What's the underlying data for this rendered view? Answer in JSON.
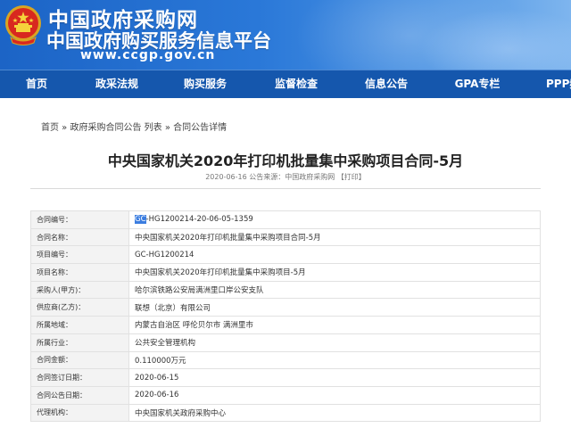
{
  "header": {
    "site_name": "中国政府采购网",
    "site_subtitle": "中国政府购买服务信息平台",
    "url": "www.ccgp.gov.cn",
    "emblem_icon": "national-emblem-icon",
    "colors": {
      "banner": "#2a78d8",
      "nav": "#1557ad"
    }
  },
  "nav": {
    "items": [
      {
        "label": "首页"
      },
      {
        "label": "政采法规"
      },
      {
        "label": "购买服务"
      },
      {
        "label": "监督检查"
      },
      {
        "label": "信息公告"
      },
      {
        "label": "GPA专栏"
      },
      {
        "label": "PPP频"
      }
    ]
  },
  "breadcrumb": {
    "home": "首页",
    "sep1": " » ",
    "list": "政府采购合同公告 列表",
    "sep2": " » ",
    "current": "合同公告详情"
  },
  "article": {
    "title": "中央国家机关2020年打印机批量集中采购项目合同-5月",
    "meta": "2020-06-16 公告来源：中国政府采购网 【打印】"
  },
  "contract": {
    "rows": [
      {
        "key": "合同编号：",
        "value_sel": "GC",
        "value": "-HG1200214-20-06-05-1359"
      },
      {
        "key": "合同名称：",
        "value": "中央国家机关2020年打印机批量集中采购项目合同-5月"
      },
      {
        "key": "项目编号：",
        "value": "GC-HG1200214"
      },
      {
        "key": "项目名称：",
        "value": "中央国家机关2020年打印机批量集中采购项目-5月"
      },
      {
        "key": "采购人(甲方)：",
        "value": "哈尔滨铁路公安局满洲里口岸公安支队"
      },
      {
        "key": "供应商(乙方)：",
        "value": "联想（北京）有限公司"
      },
      {
        "key": "所属地域：",
        "value": "内蒙古自治区 呼伦贝尔市 满洲里市"
      },
      {
        "key": "所属行业：",
        "value": "公共安全管理机构"
      },
      {
        "key": "合同金额：",
        "value": "0.110000万元"
      },
      {
        "key": "合同签订日期：",
        "value": "2020-06-15"
      },
      {
        "key": "合同公告日期：",
        "value": "2020-06-16"
      },
      {
        "key": "代理机构：",
        "value": "中央国家机关政府采购中心"
      }
    ]
  }
}
